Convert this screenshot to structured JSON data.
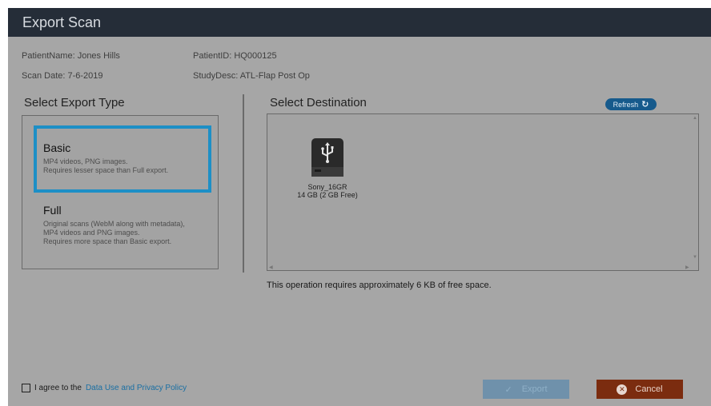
{
  "window": {
    "title": "Export Scan"
  },
  "patient": {
    "name": "PatientName: Jones Hills",
    "id": "PatientID: HQ000125",
    "scan_date": "Scan Date: 7-6-2019",
    "study_desc": "StudyDesc: ATL-Flap Post Op"
  },
  "export_type": {
    "heading": "Select Export Type",
    "options": [
      {
        "title": "Basic",
        "desc": [
          "MP4 videos, PNG images.",
          "Requires lesser space than Full export."
        ],
        "selected": true
      },
      {
        "title": "Full",
        "desc": [
          "Original scans (WebM along with metadata),",
          "MP4 videos and PNG images.",
          "Requires more space than Basic export."
        ],
        "selected": false
      }
    ]
  },
  "destination": {
    "heading": "Select Destination",
    "refresh_label": "Refresh",
    "refresh_icon": "refresh-icon",
    "devices": [
      {
        "name": "Sony_16GR",
        "size": "14 GB (2 GB Free)",
        "icon": "usb-drive-icon"
      }
    ]
  },
  "space_note": "This operation requires approximately 6 KB of free space.",
  "agreement": {
    "prefix": "I agree to the",
    "link": "Data Use and Privacy Policy",
    "checked": false
  },
  "buttons": {
    "export_label": "Export",
    "export_icon": "check-icon",
    "cancel_label": "Cancel",
    "cancel_icon": "close-circle-icon"
  },
  "colors": {
    "titlebar": "#252d38",
    "selection": "#1d8fc6",
    "refresh": "#165a8c",
    "export": "#6f91ab",
    "cancel": "#7b2c0f",
    "link": "#1a6fa3"
  }
}
